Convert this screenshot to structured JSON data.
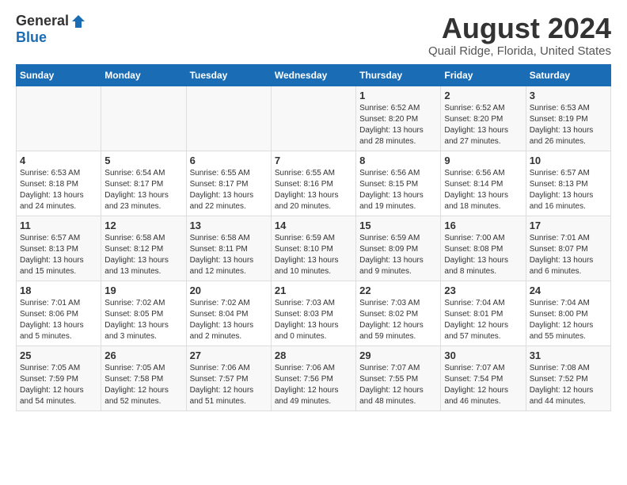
{
  "header": {
    "logo_general": "General",
    "logo_blue": "Blue",
    "title": "August 2024",
    "subtitle": "Quail Ridge, Florida, United States"
  },
  "calendar": {
    "days": [
      "Sunday",
      "Monday",
      "Tuesday",
      "Wednesday",
      "Thursday",
      "Friday",
      "Saturday"
    ],
    "weeks": [
      [
        {
          "date": "",
          "sunrise": "",
          "sunset": "",
          "daylight": ""
        },
        {
          "date": "",
          "sunrise": "",
          "sunset": "",
          "daylight": ""
        },
        {
          "date": "",
          "sunrise": "",
          "sunset": "",
          "daylight": ""
        },
        {
          "date": "",
          "sunrise": "",
          "sunset": "",
          "daylight": ""
        },
        {
          "date": "1",
          "sunrise": "Sunrise: 6:52 AM",
          "sunset": "Sunset: 8:20 PM",
          "daylight": "Daylight: 13 hours and 28 minutes."
        },
        {
          "date": "2",
          "sunrise": "Sunrise: 6:52 AM",
          "sunset": "Sunset: 8:20 PM",
          "daylight": "Daylight: 13 hours and 27 minutes."
        },
        {
          "date": "3",
          "sunrise": "Sunrise: 6:53 AM",
          "sunset": "Sunset: 8:19 PM",
          "daylight": "Daylight: 13 hours and 26 minutes."
        }
      ],
      [
        {
          "date": "4",
          "sunrise": "Sunrise: 6:53 AM",
          "sunset": "Sunset: 8:18 PM",
          "daylight": "Daylight: 13 hours and 24 minutes."
        },
        {
          "date": "5",
          "sunrise": "Sunrise: 6:54 AM",
          "sunset": "Sunset: 8:17 PM",
          "daylight": "Daylight: 13 hours and 23 minutes."
        },
        {
          "date": "6",
          "sunrise": "Sunrise: 6:55 AM",
          "sunset": "Sunset: 8:17 PM",
          "daylight": "Daylight: 13 hours and 22 minutes."
        },
        {
          "date": "7",
          "sunrise": "Sunrise: 6:55 AM",
          "sunset": "Sunset: 8:16 PM",
          "daylight": "Daylight: 13 hours and 20 minutes."
        },
        {
          "date": "8",
          "sunrise": "Sunrise: 6:56 AM",
          "sunset": "Sunset: 8:15 PM",
          "daylight": "Daylight: 13 hours and 19 minutes."
        },
        {
          "date": "9",
          "sunrise": "Sunrise: 6:56 AM",
          "sunset": "Sunset: 8:14 PM",
          "daylight": "Daylight: 13 hours and 18 minutes."
        },
        {
          "date": "10",
          "sunrise": "Sunrise: 6:57 AM",
          "sunset": "Sunset: 8:13 PM",
          "daylight": "Daylight: 13 hours and 16 minutes."
        }
      ],
      [
        {
          "date": "11",
          "sunrise": "Sunrise: 6:57 AM",
          "sunset": "Sunset: 8:13 PM",
          "daylight": "Daylight: 13 hours and 15 minutes."
        },
        {
          "date": "12",
          "sunrise": "Sunrise: 6:58 AM",
          "sunset": "Sunset: 8:12 PM",
          "daylight": "Daylight: 13 hours and 13 minutes."
        },
        {
          "date": "13",
          "sunrise": "Sunrise: 6:58 AM",
          "sunset": "Sunset: 8:11 PM",
          "daylight": "Daylight: 13 hours and 12 minutes."
        },
        {
          "date": "14",
          "sunrise": "Sunrise: 6:59 AM",
          "sunset": "Sunset: 8:10 PM",
          "daylight": "Daylight: 13 hours and 10 minutes."
        },
        {
          "date": "15",
          "sunrise": "Sunrise: 6:59 AM",
          "sunset": "Sunset: 8:09 PM",
          "daylight": "Daylight: 13 hours and 9 minutes."
        },
        {
          "date": "16",
          "sunrise": "Sunrise: 7:00 AM",
          "sunset": "Sunset: 8:08 PM",
          "daylight": "Daylight: 13 hours and 8 minutes."
        },
        {
          "date": "17",
          "sunrise": "Sunrise: 7:01 AM",
          "sunset": "Sunset: 8:07 PM",
          "daylight": "Daylight: 13 hours and 6 minutes."
        }
      ],
      [
        {
          "date": "18",
          "sunrise": "Sunrise: 7:01 AM",
          "sunset": "Sunset: 8:06 PM",
          "daylight": "Daylight: 13 hours and 5 minutes."
        },
        {
          "date": "19",
          "sunrise": "Sunrise: 7:02 AM",
          "sunset": "Sunset: 8:05 PM",
          "daylight": "Daylight: 13 hours and 3 minutes."
        },
        {
          "date": "20",
          "sunrise": "Sunrise: 7:02 AM",
          "sunset": "Sunset: 8:04 PM",
          "daylight": "Daylight: 13 hours and 2 minutes."
        },
        {
          "date": "21",
          "sunrise": "Sunrise: 7:03 AM",
          "sunset": "Sunset: 8:03 PM",
          "daylight": "Daylight: 13 hours and 0 minutes."
        },
        {
          "date": "22",
          "sunrise": "Sunrise: 7:03 AM",
          "sunset": "Sunset: 8:02 PM",
          "daylight": "Daylight: 12 hours and 59 minutes."
        },
        {
          "date": "23",
          "sunrise": "Sunrise: 7:04 AM",
          "sunset": "Sunset: 8:01 PM",
          "daylight": "Daylight: 12 hours and 57 minutes."
        },
        {
          "date": "24",
          "sunrise": "Sunrise: 7:04 AM",
          "sunset": "Sunset: 8:00 PM",
          "daylight": "Daylight: 12 hours and 55 minutes."
        }
      ],
      [
        {
          "date": "25",
          "sunrise": "Sunrise: 7:05 AM",
          "sunset": "Sunset: 7:59 PM",
          "daylight": "Daylight: 12 hours and 54 minutes."
        },
        {
          "date": "26",
          "sunrise": "Sunrise: 7:05 AM",
          "sunset": "Sunset: 7:58 PM",
          "daylight": "Daylight: 12 hours and 52 minutes."
        },
        {
          "date": "27",
          "sunrise": "Sunrise: 7:06 AM",
          "sunset": "Sunset: 7:57 PM",
          "daylight": "Daylight: 12 hours and 51 minutes."
        },
        {
          "date": "28",
          "sunrise": "Sunrise: 7:06 AM",
          "sunset": "Sunset: 7:56 PM",
          "daylight": "Daylight: 12 hours and 49 minutes."
        },
        {
          "date": "29",
          "sunrise": "Sunrise: 7:07 AM",
          "sunset": "Sunset: 7:55 PM",
          "daylight": "Daylight: 12 hours and 48 minutes."
        },
        {
          "date": "30",
          "sunrise": "Sunrise: 7:07 AM",
          "sunset": "Sunset: 7:54 PM",
          "daylight": "Daylight: 12 hours and 46 minutes."
        },
        {
          "date": "31",
          "sunrise": "Sunrise: 7:08 AM",
          "sunset": "Sunset: 7:52 PM",
          "daylight": "Daylight: 12 hours and 44 minutes."
        }
      ]
    ]
  }
}
